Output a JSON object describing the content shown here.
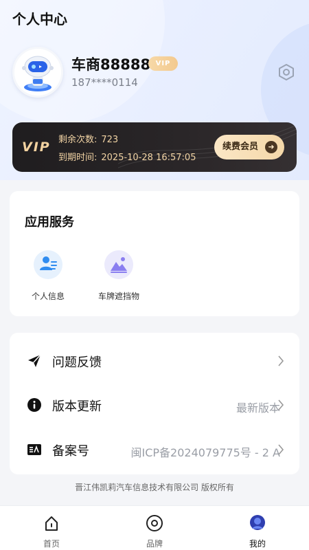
{
  "header": {
    "title": "个人中心"
  },
  "profile": {
    "username": "车商88888",
    "vip_tag": "VIP",
    "phone": "187****0114"
  },
  "vip_card": {
    "logo": "VIP",
    "remaining_label": "剩余次数:",
    "remaining_value": "723",
    "expire_label": "到期时间:",
    "expire_value": "2025-10-28 16:57:05",
    "renew_label": "续费会员"
  },
  "services": {
    "title": "应用服务",
    "items": [
      {
        "label": "个人信息",
        "icon": "user-card-icon"
      },
      {
        "label": "车牌遮挡物",
        "icon": "image-mountain-icon"
      }
    ]
  },
  "menu": [
    {
      "label": "问题反馈",
      "value": "",
      "icon": "send-icon"
    },
    {
      "label": "版本更新",
      "value": "最新版本",
      "icon": "info-icon"
    },
    {
      "label": "备案号",
      "value": "闽ICP备2024079775号 - 2 A",
      "icon": "record-icon"
    }
  ],
  "footer": {
    "copyright": "晋江伟凯莉汽车信息技术有限公司 版权所有"
  },
  "tabbar": [
    {
      "label": "首页",
      "icon": "home-icon",
      "active": false
    },
    {
      "label": "品牌",
      "icon": "brand-icon",
      "active": false
    },
    {
      "label": "我的",
      "icon": "profile-icon",
      "active": true
    }
  ],
  "colors": {
    "accent": "#2f54eb",
    "vip_gold": "#f1d3a4",
    "vip_dark": "#1f1d1f"
  }
}
